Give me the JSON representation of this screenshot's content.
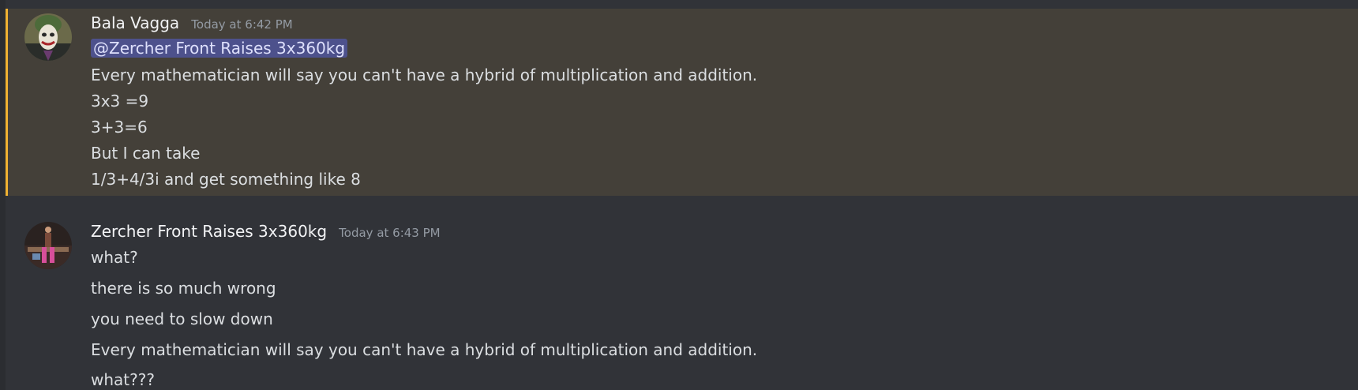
{
  "messages": [
    {
      "author": "Bala Vagga",
      "timestamp": "Today at 6:42 PM",
      "avatar_icon": "joker-avatar",
      "mention": "@Zercher Front Raises 3x360kg",
      "lines": [
        "Every mathematician will say you can't have a hybrid of multiplication and addition.",
        "3x3 =9",
        "3+3=6",
        "But I can take",
        "1/3+4/3i and get something like  8"
      ]
    },
    {
      "author": "Zercher Front Raises 3x360kg",
      "timestamp": "Today at 6:43 PM",
      "avatar_icon": "stage-performer-avatar",
      "lines": [
        "what?",
        "there is so much wrong",
        "you need to slow down",
        "Every mathematician will say you can't have a hybrid of multiplication and addition.",
        "what???"
      ]
    }
  ],
  "colors": {
    "background": "#313338",
    "highlight_background": "#444039",
    "highlight_bar": "#f0b232",
    "mention_background": "#4c4f8f",
    "username": "#f2f3f5",
    "timestamp": "#949ba4"
  }
}
